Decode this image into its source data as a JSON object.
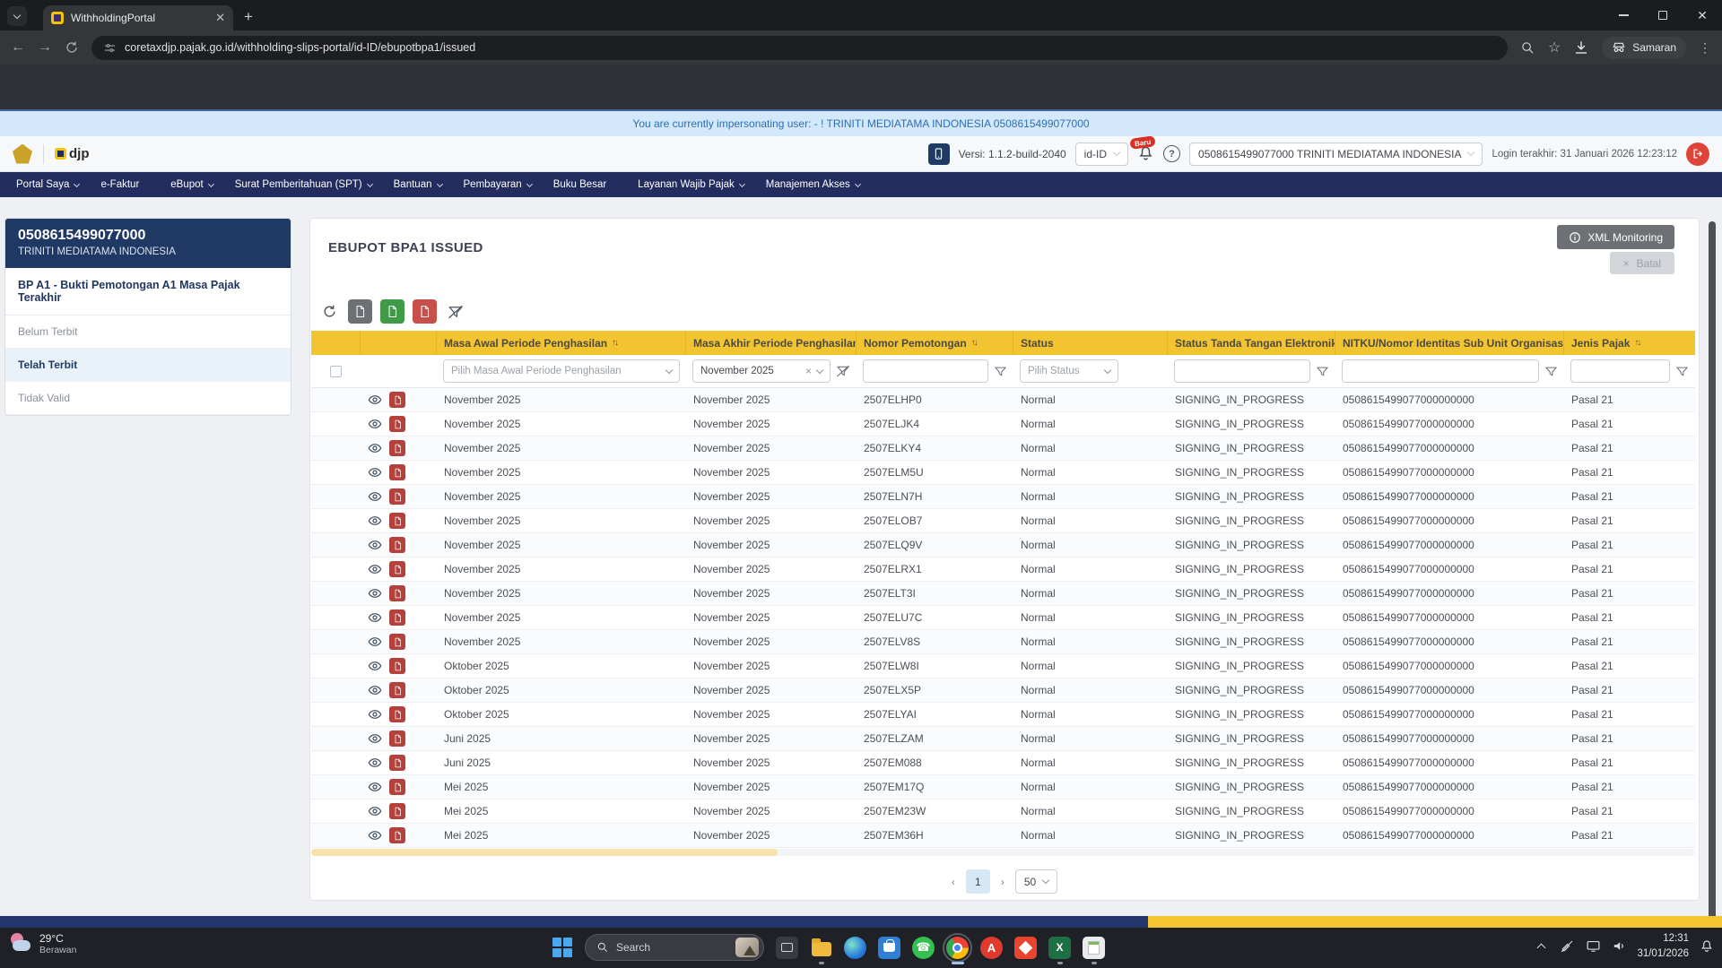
{
  "browser": {
    "tab_title": "WithholdingPortal",
    "url": "coretaxdjp.pajak.go.id/withholding-slips-portal/id-ID/ebupotbpa1/issued",
    "incognito_label": "Samaran"
  },
  "banner": {
    "text": "You are currently impersonating user: - ! TRINITI MEDIATAMA INDONESIA 0508615499077000"
  },
  "app_header": {
    "brand": "djp",
    "version_label": "Versi:",
    "version": "1.1.2-build-2040",
    "locale": "id-ID",
    "new_badge": "Baru",
    "help": "?",
    "account": "0508615499077000 TRINITI MEDIATAMA INDONESIA",
    "last_login": "Login terakhir: 31 Januari 2026 12:23:12"
  },
  "nav": {
    "items": [
      {
        "label": "Portal Saya",
        "caret": true
      },
      {
        "label": "e-Faktur",
        "caret": false
      },
      {
        "label": "eBupot",
        "caret": true
      },
      {
        "label": "Surat Pemberitahuan (SPT)",
        "caret": true
      },
      {
        "label": "Bantuan",
        "caret": true
      },
      {
        "label": "Pembayaran",
        "caret": true
      },
      {
        "label": "Buku Besar",
        "caret": false
      },
      {
        "label": "Layanan Wajib Pajak",
        "caret": true
      },
      {
        "label": "Manajemen Akses",
        "caret": true
      }
    ]
  },
  "sidebar": {
    "npwp": "0508615499077000",
    "company": "TRINITI MEDIATAMA INDONESIA",
    "section": "BP A1 - Bukti Pemotongan A1 Masa Pajak Terakhir",
    "items": [
      {
        "label": "Belum Terbit",
        "active": false
      },
      {
        "label": "Telah Terbit",
        "active": true
      },
      {
        "label": "Tidak Valid",
        "active": false
      }
    ]
  },
  "main": {
    "title": "EBUPOT BPA1 ISSUED",
    "xml_monitoring_label": "XML Monitoring",
    "cancel_label": "Batal",
    "cancel_x": "×"
  },
  "table": {
    "headers": [
      {
        "label": "Masa Awal Periode Penghasilan",
        "sort": true
      },
      {
        "label": "Masa Akhir Periode Penghasilan...",
        "sort": false
      },
      {
        "label": "Nomor Pemotongan",
        "sort": true
      },
      {
        "label": "Status",
        "sort": false
      },
      {
        "label": "Status Tanda Tangan Elektronik...",
        "sort": false
      },
      {
        "label": "NITKU/Nomor Identitas Sub Unit Organisasi",
        "sort": true
      },
      {
        "label": "Jenis Pajak",
        "sort": true
      }
    ],
    "filters": {
      "masa_awal_placeholder": "Pilih Masa Awal Periode Penghasilan",
      "masa_akhir_value": "November 2025",
      "status_placeholder": "Pilih Status"
    },
    "rows": [
      {
        "awal": "November 2025",
        "akhir": "November 2025",
        "nomor": "2507ELHP0",
        "status": "Normal",
        "tte": "SIGNING_IN_PROGRESS",
        "nitku": "0508615499077000000000",
        "jenis": "Pasal 21"
      },
      {
        "awal": "November 2025",
        "akhir": "November 2025",
        "nomor": "2507ELJK4",
        "status": "Normal",
        "tte": "SIGNING_IN_PROGRESS",
        "nitku": "0508615499077000000000",
        "jenis": "Pasal 21"
      },
      {
        "awal": "November 2025",
        "akhir": "November 2025",
        "nomor": "2507ELKY4",
        "status": "Normal",
        "tte": "SIGNING_IN_PROGRESS",
        "nitku": "0508615499077000000000",
        "jenis": "Pasal 21"
      },
      {
        "awal": "November 2025",
        "akhir": "November 2025",
        "nomor": "2507ELM5U",
        "status": "Normal",
        "tte": "SIGNING_IN_PROGRESS",
        "nitku": "0508615499077000000000",
        "jenis": "Pasal 21"
      },
      {
        "awal": "November 2025",
        "akhir": "November 2025",
        "nomor": "2507ELN7H",
        "status": "Normal",
        "tte": "SIGNING_IN_PROGRESS",
        "nitku": "0508615499077000000000",
        "jenis": "Pasal 21"
      },
      {
        "awal": "November 2025",
        "akhir": "November 2025",
        "nomor": "2507ELOB7",
        "status": "Normal",
        "tte": "SIGNING_IN_PROGRESS",
        "nitku": "0508615499077000000000",
        "jenis": "Pasal 21"
      },
      {
        "awal": "November 2025",
        "akhir": "November 2025",
        "nomor": "2507ELQ9V",
        "status": "Normal",
        "tte": "SIGNING_IN_PROGRESS",
        "nitku": "0508615499077000000000",
        "jenis": "Pasal 21"
      },
      {
        "awal": "November 2025",
        "akhir": "November 2025",
        "nomor": "2507ELRX1",
        "status": "Normal",
        "tte": "SIGNING_IN_PROGRESS",
        "nitku": "0508615499077000000000",
        "jenis": "Pasal 21"
      },
      {
        "awal": "November 2025",
        "akhir": "November 2025",
        "nomor": "2507ELT3I",
        "status": "Normal",
        "tte": "SIGNING_IN_PROGRESS",
        "nitku": "0508615499077000000000",
        "jenis": "Pasal 21"
      },
      {
        "awal": "November 2025",
        "akhir": "November 2025",
        "nomor": "2507ELU7C",
        "status": "Normal",
        "tte": "SIGNING_IN_PROGRESS",
        "nitku": "0508615499077000000000",
        "jenis": "Pasal 21"
      },
      {
        "awal": "November 2025",
        "akhir": "November 2025",
        "nomor": "2507ELV8S",
        "status": "Normal",
        "tte": "SIGNING_IN_PROGRESS",
        "nitku": "0508615499077000000000",
        "jenis": "Pasal 21"
      },
      {
        "awal": "Oktober 2025",
        "akhir": "November 2025",
        "nomor": "2507ELW8I",
        "status": "Normal",
        "tte": "SIGNING_IN_PROGRESS",
        "nitku": "0508615499077000000000",
        "jenis": "Pasal 21"
      },
      {
        "awal": "Oktober 2025",
        "akhir": "November 2025",
        "nomor": "2507ELX5P",
        "status": "Normal",
        "tte": "SIGNING_IN_PROGRESS",
        "nitku": "0508615499077000000000",
        "jenis": "Pasal 21"
      },
      {
        "awal": "Oktober 2025",
        "akhir": "November 2025",
        "nomor": "2507ELYAI",
        "status": "Normal",
        "tte": "SIGNING_IN_PROGRESS",
        "nitku": "0508615499077000000000",
        "jenis": "Pasal 21"
      },
      {
        "awal": "Juni 2025",
        "akhir": "November 2025",
        "nomor": "2507ELZAM",
        "status": "Normal",
        "tte": "SIGNING_IN_PROGRESS",
        "nitku": "0508615499077000000000",
        "jenis": "Pasal 21"
      },
      {
        "awal": "Juni 2025",
        "akhir": "November 2025",
        "nomor": "2507EM088",
        "status": "Normal",
        "tte": "SIGNING_IN_PROGRESS",
        "nitku": "0508615499077000000000",
        "jenis": "Pasal 21"
      },
      {
        "awal": "Mei 2025",
        "akhir": "November 2025",
        "nomor": "2507EM17Q",
        "status": "Normal",
        "tte": "SIGNING_IN_PROGRESS",
        "nitku": "0508615499077000000000",
        "jenis": "Pasal 21"
      },
      {
        "awal": "Mei 2025",
        "akhir": "November 2025",
        "nomor": "2507EM23W",
        "status": "Normal",
        "tte": "SIGNING_IN_PROGRESS",
        "nitku": "0508615499077000000000",
        "jenis": "Pasal 21"
      },
      {
        "awal": "Mei 2025",
        "akhir": "November 2025",
        "nomor": "2507EM36H",
        "status": "Normal",
        "tte": "SIGNING_IN_PROGRESS",
        "nitku": "0508615499077000000000",
        "jenis": "Pasal 21"
      }
    ]
  },
  "pagination": {
    "prev": "‹",
    "page": "1",
    "next": "›",
    "page_size": "50"
  },
  "taskbar": {
    "weather_temp": "29°C",
    "weather_desc": "Berawan",
    "search_placeholder": "Search",
    "whatsapp_glyph": "☎",
    "red_app_glyph": "A",
    "sheets_glyph": "X",
    "time": "12:31",
    "date": "31/01/2026"
  }
}
